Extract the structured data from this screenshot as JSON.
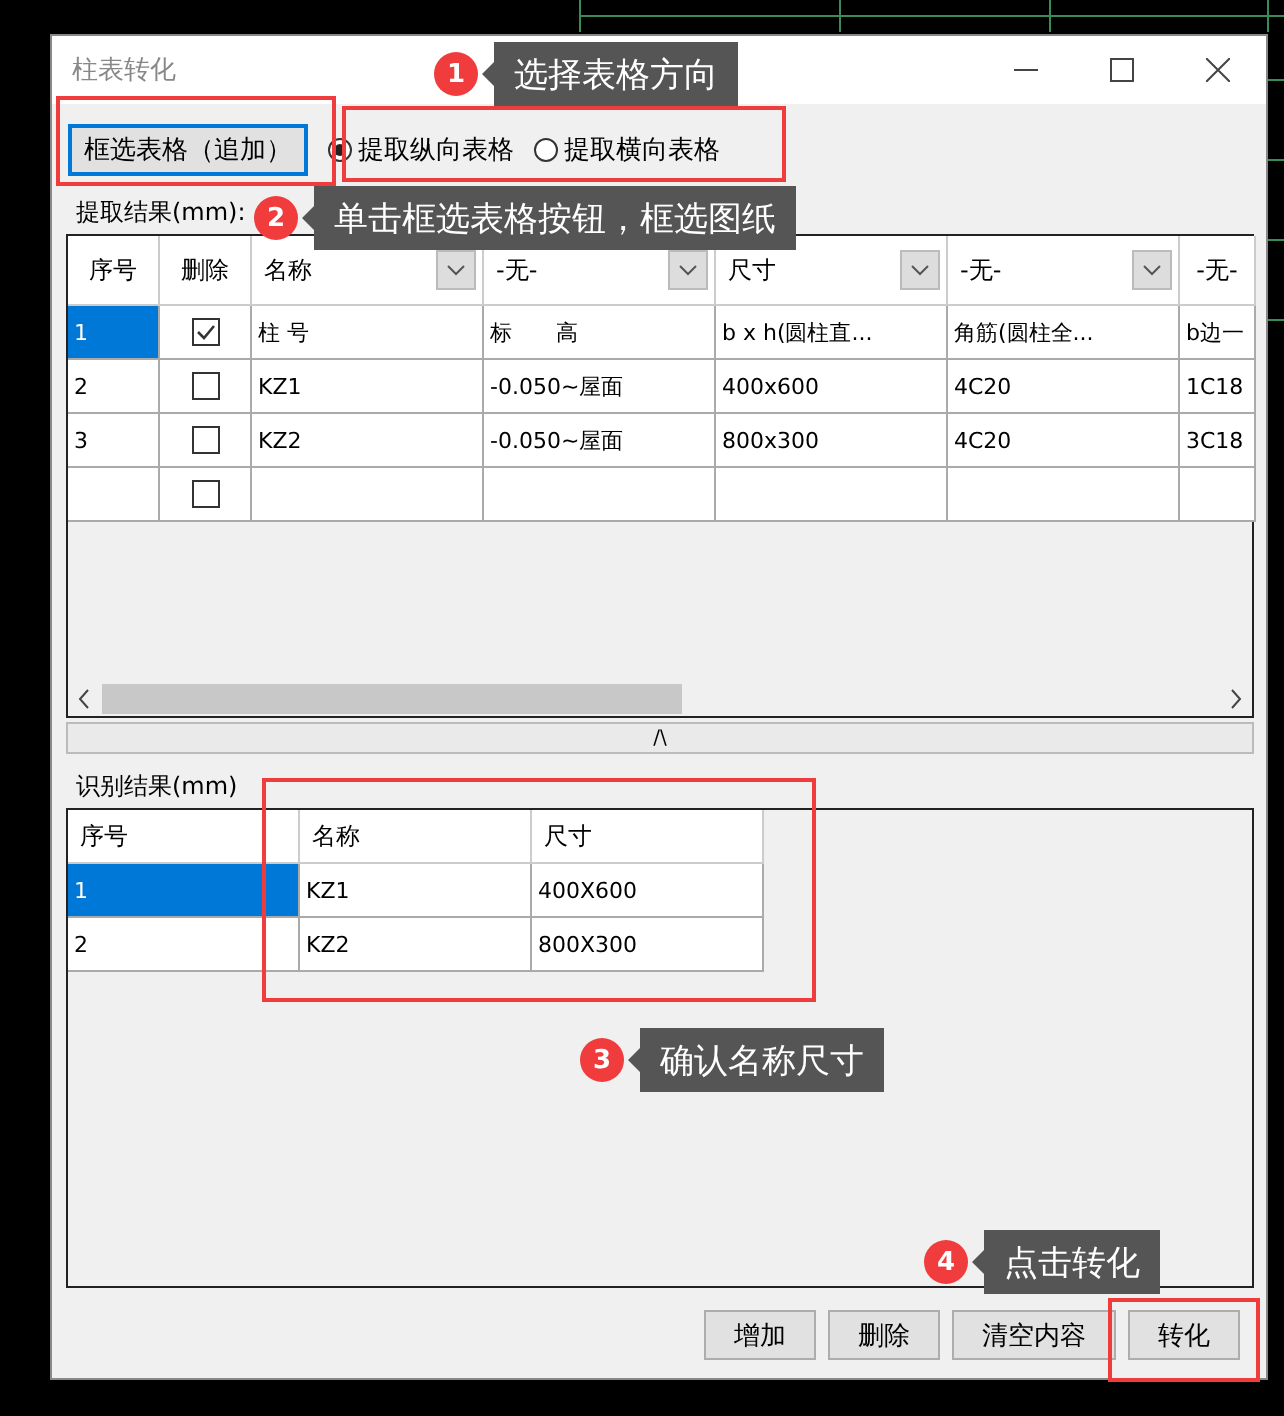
{
  "window": {
    "title": "柱表转化"
  },
  "select_button": "框选表格（追加）",
  "orientation_options": [
    {
      "label": "提取纵向表格",
      "selected": true
    },
    {
      "label": "提取横向表格",
      "selected": false
    }
  ],
  "extract_results": {
    "label": "提取结果(mm):",
    "columns": [
      {
        "label": "序号",
        "kind": "plain"
      },
      {
        "label": "删除",
        "kind": "plain"
      },
      {
        "label": "名称",
        "kind": "dropdown"
      },
      {
        "label": "-无-",
        "kind": "dropdown"
      },
      {
        "label": "尺寸",
        "kind": "dropdown"
      },
      {
        "label": "-无-",
        "kind": "dropdown"
      },
      {
        "label": "-无-",
        "kind": "plain"
      }
    ],
    "rows": [
      {
        "index": "1",
        "selected": true,
        "delete": true,
        "cells": [
          "柱 号",
          "标　　高",
          "b x h(圆柱直...",
          "角筋(圆柱全...",
          "b边一"
        ]
      },
      {
        "index": "2",
        "selected": false,
        "delete": false,
        "cells": [
          "KZ1",
          "-0.050~屋面",
          "400x600",
          "4C20",
          "1C18"
        ]
      },
      {
        "index": "3",
        "selected": false,
        "delete": false,
        "cells": [
          "KZ2",
          "-0.050~屋面",
          "800x300",
          "4C20",
          "3C18"
        ]
      },
      {
        "selected": false,
        "delete": false
      }
    ],
    "splitter": "/\\"
  },
  "recognition_results": {
    "label": "识别结果(mm)",
    "columns": [
      "序号",
      "名称",
      "尺寸"
    ],
    "rows": [
      {
        "selected": true,
        "cells": [
          "1",
          "KZ1",
          "400X600"
        ]
      },
      {
        "selected": false,
        "cells": [
          "2",
          "KZ2",
          "800X300"
        ]
      }
    ]
  },
  "buttons": [
    "增加",
    "删除",
    "清空内容",
    "转化"
  ],
  "callouts": [
    {
      "number": "1",
      "text": "选择表格方向"
    },
    {
      "number": "2",
      "text": "单击框选表格按钮，框选图纸"
    },
    {
      "number": "3",
      "text": "确认名称尺寸"
    },
    {
      "number": "4",
      "text": "点击转化"
    }
  ]
}
